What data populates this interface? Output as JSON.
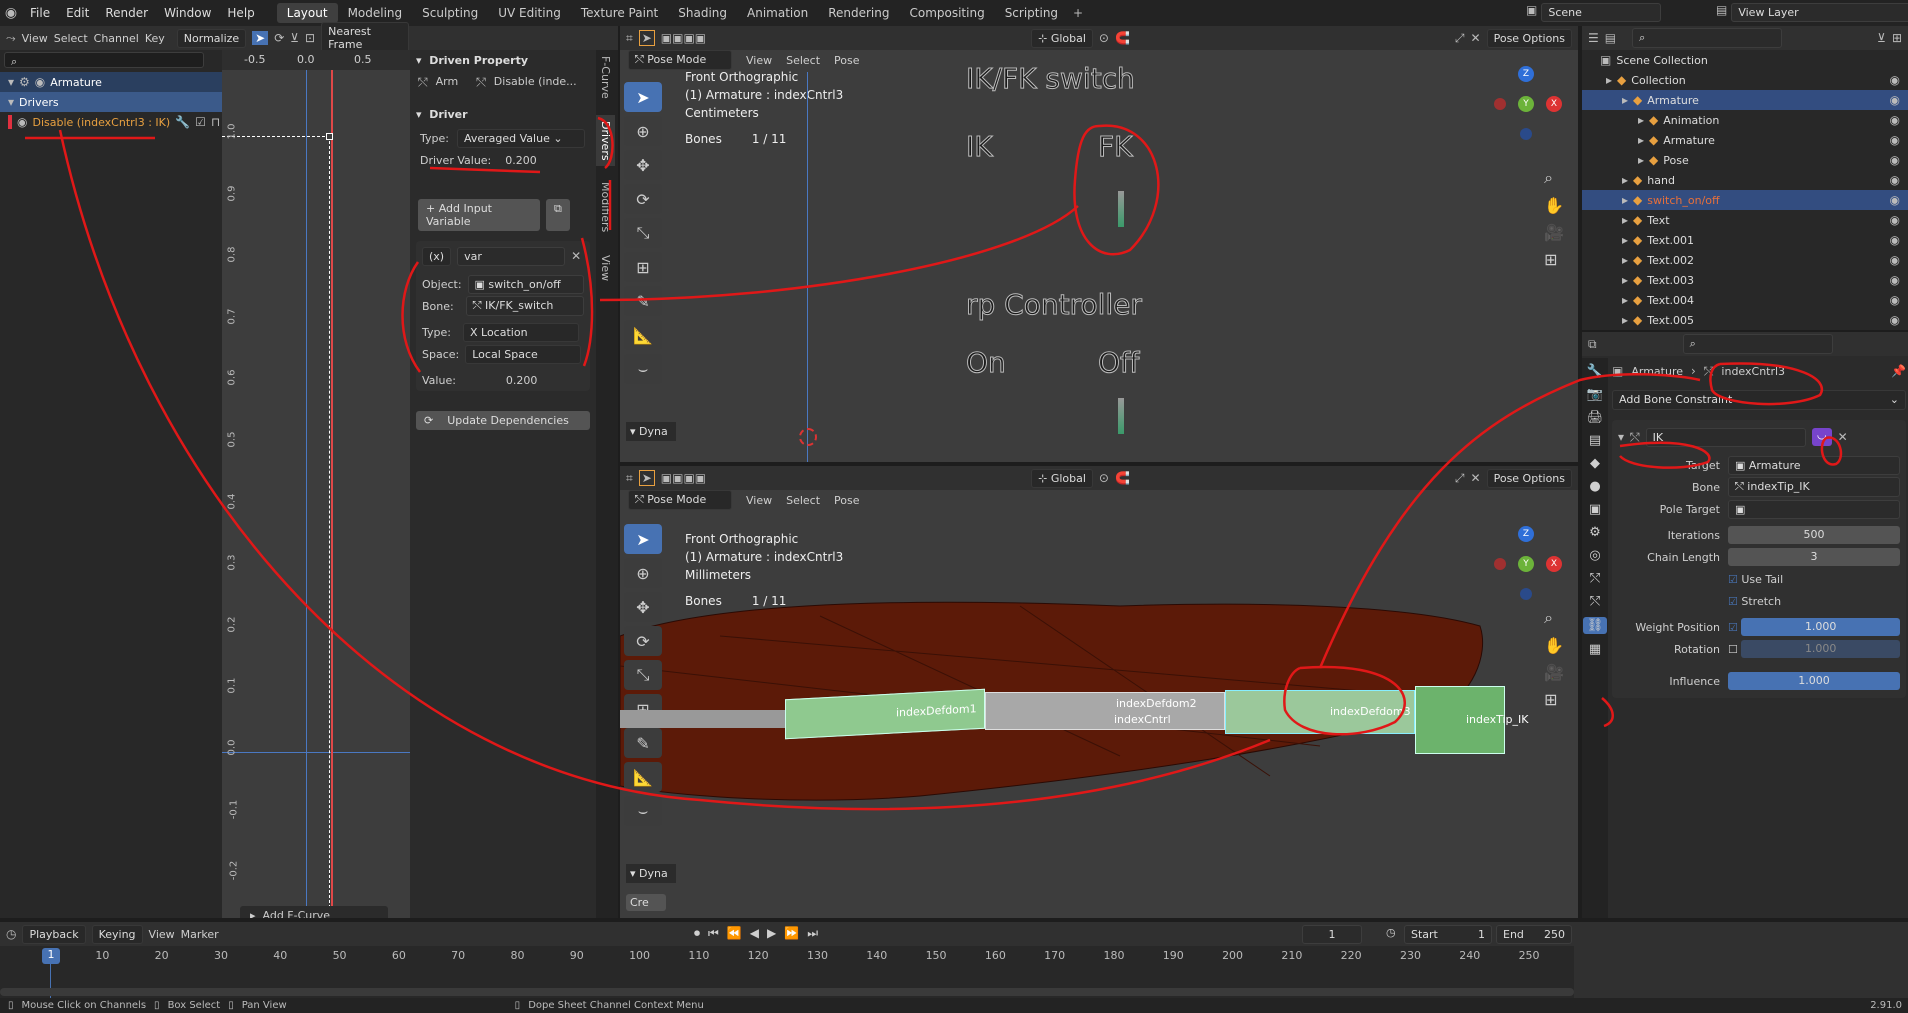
{
  "topbar": {
    "menus": [
      "File",
      "Edit",
      "Render",
      "Window",
      "Help"
    ],
    "workspaces": [
      "Layout",
      "Modeling",
      "Sculpting",
      "UV Editing",
      "Texture Paint",
      "Shading",
      "Animation",
      "Rendering",
      "Compositing",
      "Scripting"
    ],
    "active": "Layout",
    "scene": "Scene",
    "view_layer": "View Layer"
  },
  "graph": {
    "header": [
      "View",
      "Select",
      "Channel",
      "Key"
    ],
    "normalize": "Normalize",
    "snap": "Nearest Frame",
    "xticks": [
      "-0.5",
      "0.0",
      "0.5"
    ],
    "yticks": [
      "1.0",
      "0.9",
      "0.8",
      "0.7",
      "0.6",
      "0.5",
      "0.4",
      "0.3",
      "0.2",
      "0.1",
      "0.0",
      "-0.1",
      "-0.2"
    ],
    "channels": {
      "armature": "Armature",
      "drivers": "Drivers",
      "driver": "Disable (indexCntrl3 : IK)"
    },
    "add_modifier": "Add F-Curve Modifier"
  },
  "driven": {
    "section": "Driven Property",
    "arm": "Arm",
    "disable": "Disable (inde...",
    "driver_section": "Driver",
    "type_label": "Type:",
    "type_value": "Averaged Value",
    "driver_value_label": "Driver Value:",
    "driver_value": "0.200",
    "add_var": "Add Input Variable",
    "var_prefix": "(x)",
    "var_name": "var",
    "object_label": "Object:",
    "object_value": "switch_on/off",
    "bone_label": "Bone:",
    "bone_value": "IK/FK_switch",
    "vtype_label": "Type:",
    "vtype_value": "X Location",
    "space_label": "Space:",
    "space_value": "Local Space",
    "value_label": "Value:",
    "value_value": "0.200",
    "update": "Update Dependencies",
    "tabs": [
      "F-Curve",
      "Drivers",
      "Modifiers",
      "View"
    ]
  },
  "vp_top": {
    "mode": "Pose Mode",
    "menus": [
      "View",
      "Select",
      "Pose"
    ],
    "transform": "Global",
    "pose_options": "Pose Options",
    "info": [
      "Front Orthographic",
      "(1) Armature : indexCntrl3",
      "Centimeters"
    ],
    "bones_label": "Bones",
    "bones_value": "1 / 11",
    "scene_text": {
      "title": "IK/FK switch",
      "ik": "IK",
      "fk": "FK",
      "controller": "rp Controller",
      "on": "On",
      "off": "Off"
    },
    "dyna": "Dyna"
  },
  "vp_bottom": {
    "mode": "Pose Mode",
    "menus": [
      "View",
      "Select",
      "Pose"
    ],
    "transform": "Global",
    "pose_options": "Pose Options",
    "info": [
      "Front Orthographic",
      "(1) Armature : indexCntrl3",
      "Millimeters"
    ],
    "bones_label": "Bones",
    "bones_value": "1 / 11",
    "bone_labels": [
      "indexDefdom1",
      "indexDefdom2",
      "indexCntrl",
      "indexDefdom3",
      "indexTip_IK"
    ],
    "dyna": "Dyna",
    "cre": "Cre"
  },
  "outliner": {
    "root": "Scene Collection",
    "items": [
      {
        "name": "Collection",
        "indent": 1
      },
      {
        "name": "Armature",
        "indent": 2,
        "selected": true
      },
      {
        "name": "Animation",
        "indent": 3
      },
      {
        "name": "Armature",
        "indent": 3
      },
      {
        "name": "Pose",
        "indent": 3
      },
      {
        "name": "hand",
        "indent": 2
      },
      {
        "name": "switch_on/off",
        "indent": 2,
        "selected": true,
        "orange": true
      },
      {
        "name": "Text",
        "indent": 2
      },
      {
        "name": "Text.001",
        "indent": 2
      },
      {
        "name": "Text.002",
        "indent": 2
      },
      {
        "name": "Text.003",
        "indent": 2
      },
      {
        "name": "Text.004",
        "indent": 2
      },
      {
        "name": "Text.005",
        "indent": 2
      }
    ]
  },
  "props": {
    "armature": "Armature",
    "bone": "indexCntrl3",
    "add_constraint": "Add Bone Constraint",
    "constraint_name": "IK",
    "target_label": "Target",
    "target_value": "Armature",
    "bone_label": "Bone",
    "bone_value": "indexTip_IK",
    "pole_label": "Pole Target",
    "iterations_label": "Iterations",
    "iterations": "500",
    "chain_label": "Chain Length",
    "chain": "3",
    "use_tail": "Use Tail",
    "stretch": "Stretch",
    "weight_pos_label": "Weight Position",
    "weight_pos": "1.000",
    "rotation_label": "Rotation",
    "rotation": "1.000",
    "influence_label": "Influence",
    "influence": "1.000"
  },
  "timeline": {
    "menus": [
      "Playback",
      "Keying",
      "View",
      "Marker"
    ],
    "current": "1",
    "start_label": "Start",
    "start": "1",
    "end_label": "End",
    "end": "250",
    "ticks": [
      "1",
      "10",
      "20",
      "30",
      "40",
      "50",
      "60",
      "70",
      "80",
      "90",
      "100",
      "110",
      "120",
      "130",
      "140",
      "150",
      "160",
      "170",
      "180",
      "190",
      "200",
      "210",
      "220",
      "230",
      "240",
      "250"
    ]
  },
  "status": {
    "hint1": "Mouse Click on Channels",
    "hint2": "Box Select",
    "hint3": "Pan View",
    "hint4": "Dope Sheet Channel Context Menu",
    "version": "2.91.0"
  }
}
